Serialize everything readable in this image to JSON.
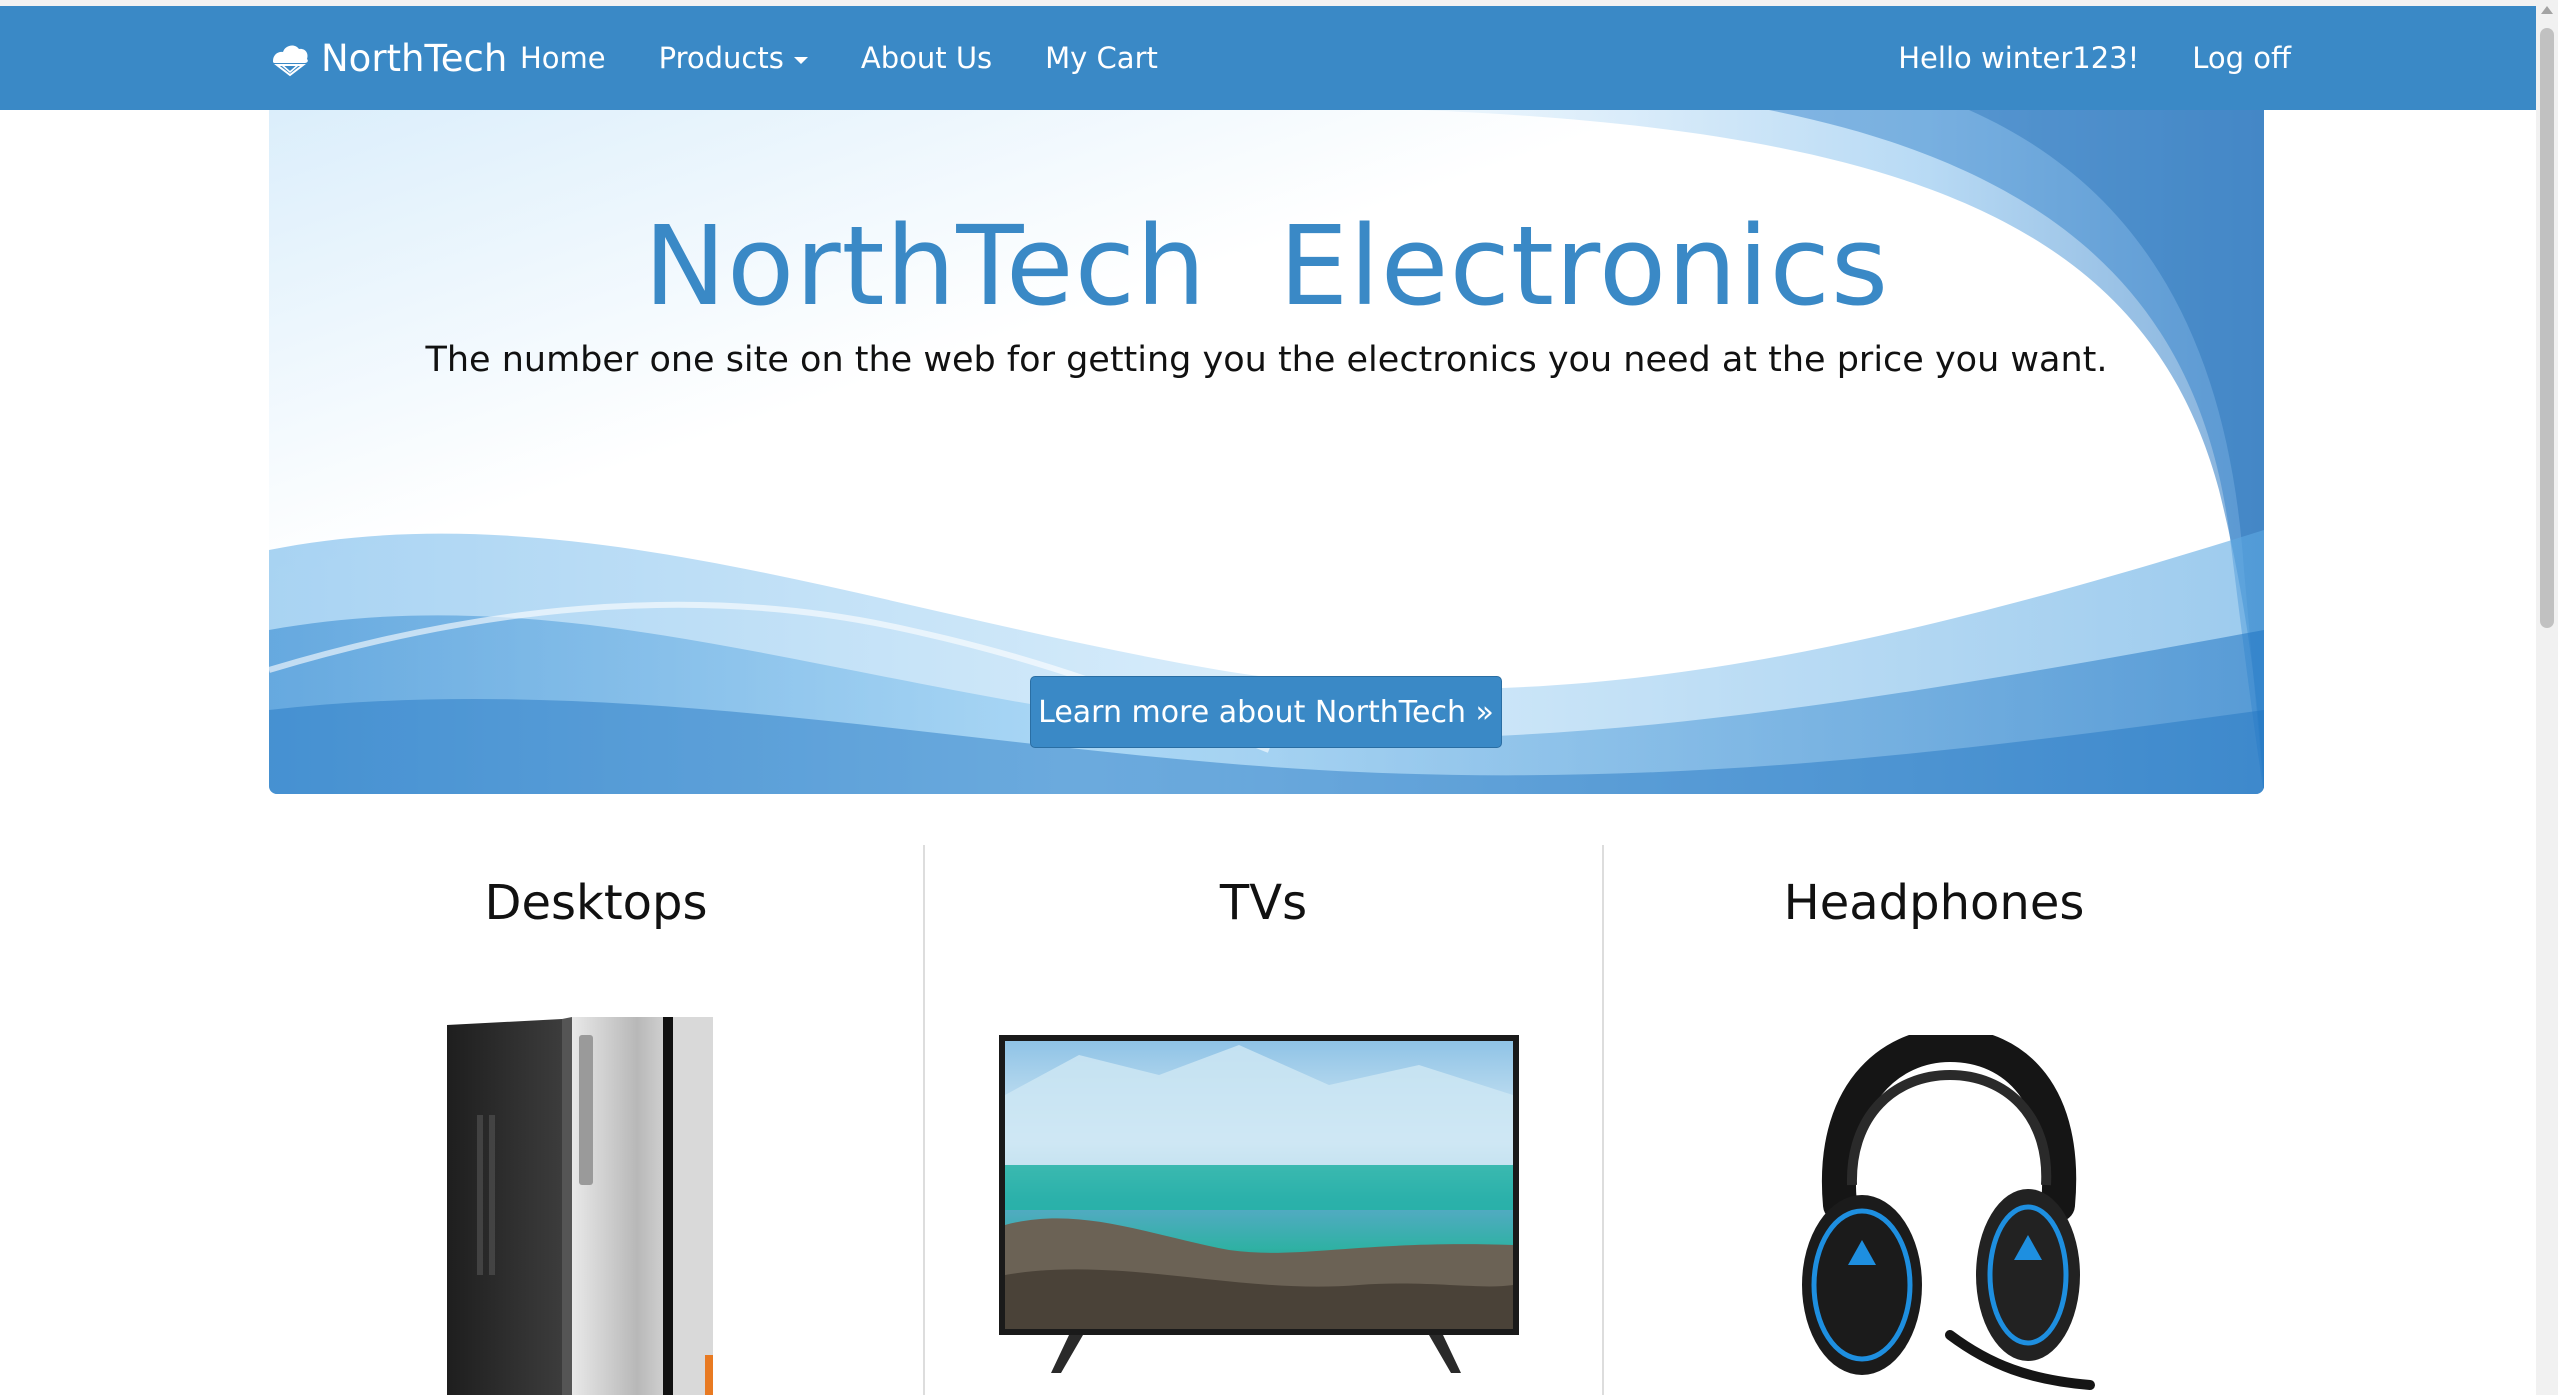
{
  "brand": {
    "name": "NorthTech",
    "logo_icon": "cloud-mountain-icon"
  },
  "nav": {
    "items": [
      {
        "label": "Home"
      },
      {
        "label": "Products",
        "has_dropdown": true
      },
      {
        "label": "About Us"
      },
      {
        "label": "My Cart"
      }
    ],
    "greeting": "Hello winter123!",
    "logoff": "Log off"
  },
  "hero": {
    "title": "NorthTech  Electronics",
    "subtitle": "The number one site on the web for getting you the electronics you need at the price you want.",
    "button_label": "Learn more about NorthTech »"
  },
  "categories": [
    {
      "title": "Desktops",
      "image_icon": "desktop-tower-icon"
    },
    {
      "title": "TVs",
      "image_icon": "flat-tv-icon"
    },
    {
      "title": "Headphones",
      "image_icon": "headset-icon"
    }
  ],
  "colors": {
    "accent": "#3a89c6",
    "text": "#111111",
    "divider": "#dddddd"
  }
}
